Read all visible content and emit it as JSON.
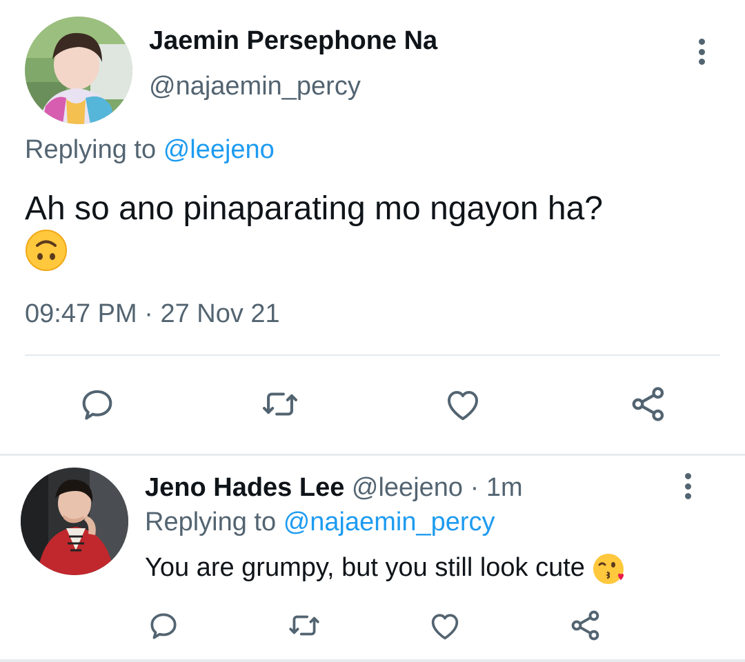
{
  "main_tweet": {
    "author_name": "Jaemin Persephone Na",
    "author_handle": "@najaemin_percy",
    "replying_prefix": "Replying to",
    "replying_to": "@leejeno",
    "text": "Ah so ano pinaparating mo ngayon ha?",
    "emoji": "upside-down-face-emoji",
    "time": "09:47 PM",
    "separator": "·",
    "date": "27 Nov 21",
    "actions": [
      "reply-icon",
      "retweet-icon",
      "like-icon",
      "share-icon"
    ]
  },
  "reply_tweet": {
    "author_name": "Jeno Hades Lee",
    "author_handle": "@leejeno",
    "separator": "·",
    "relative_time": "1m",
    "replying_prefix": "Replying to",
    "replying_to": "@najaemin_percy",
    "text": "You are grumpy, but you still look cute",
    "emoji": "face-blowing-kiss-emoji",
    "actions": [
      "reply-icon",
      "retweet-icon",
      "like-icon",
      "share-icon"
    ]
  },
  "colors": {
    "text_primary": "#0f1419",
    "text_secondary": "#536471",
    "link": "#1d9bf0",
    "divider": "#e1e8ed"
  }
}
